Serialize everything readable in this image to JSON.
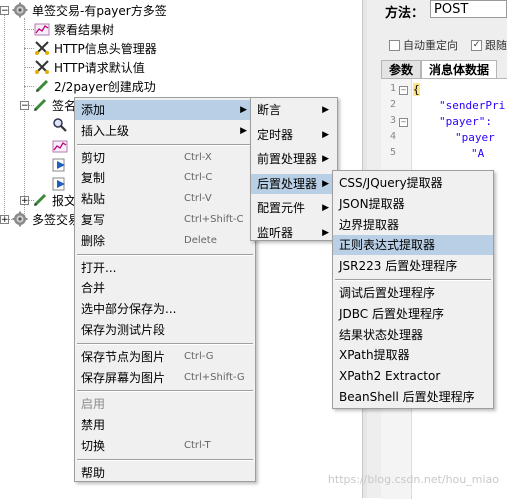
{
  "tree": {
    "nodes": [
      {
        "label": "单签交易-有payer方多签",
        "icon": "thread-group-gear-icon"
      },
      {
        "label": "察看结果树",
        "icon": "results-tree-graph-icon"
      },
      {
        "label": "HTTP信息头管理器",
        "icon": "http-header-manager-scissors-icon"
      },
      {
        "label": "HTTP请求默认值",
        "icon": "http-defaults-scissors-icon"
      },
      {
        "label": "2/2payer创建成功",
        "icon": "sampler-pencil-icon"
      },
      {
        "label": "签名",
        "icon": "sampler-pencil-icon"
      },
      {
        "label": "报文",
        "icon": "sampler-pencil-icon"
      },
      {
        "label": "多签交易",
        "icon": "thread-group-gear-icon"
      }
    ]
  },
  "right_panel": {
    "method_label": "方法：",
    "method_value": "POST",
    "auto_redirect_label": "自动重定向",
    "follow_redirect_label": "跟随",
    "tabs": [
      "参数",
      "消息体数据"
    ],
    "code_lines": [
      {
        "n": "1",
        "text": "{"
      },
      {
        "n": "2",
        "text": "\"senderPri"
      },
      {
        "n": "3",
        "text": "\"payer\":"
      },
      {
        "n": "4",
        "text": "\"payer"
      },
      {
        "n": "5",
        "text": "\"A"
      }
    ]
  },
  "context_menu": {
    "items": [
      {
        "label": "添加",
        "shortcut": "",
        "submenu": true,
        "highlight": true,
        "disabled": false
      },
      {
        "label": "插入上级",
        "shortcut": "",
        "submenu": true,
        "highlight": false,
        "disabled": false
      },
      {
        "label": "剪切",
        "shortcut": "Ctrl-X",
        "submenu": false,
        "highlight": false,
        "disabled": false
      },
      {
        "label": "复制",
        "shortcut": "Ctrl-C",
        "submenu": false,
        "highlight": false,
        "disabled": false
      },
      {
        "label": "粘贴",
        "shortcut": "Ctrl-V",
        "submenu": false,
        "highlight": false,
        "disabled": false
      },
      {
        "label": "复写",
        "shortcut": "Ctrl+Shift-C",
        "submenu": false,
        "highlight": false,
        "disabled": false
      },
      {
        "label": "删除",
        "shortcut": "Delete",
        "submenu": false,
        "highlight": false,
        "disabled": false
      },
      {
        "label": "打开...",
        "shortcut": "",
        "submenu": false,
        "highlight": false,
        "disabled": false
      },
      {
        "label": "合并",
        "shortcut": "",
        "submenu": false,
        "highlight": false,
        "disabled": false
      },
      {
        "label": "选中部分保存为...",
        "shortcut": "",
        "submenu": false,
        "highlight": false,
        "disabled": false
      },
      {
        "label": "保存为测试片段",
        "shortcut": "",
        "submenu": false,
        "highlight": false,
        "disabled": false
      },
      {
        "label": "保存节点为图片",
        "shortcut": "Ctrl-G",
        "submenu": false,
        "highlight": false,
        "disabled": false
      },
      {
        "label": "保存屏幕为图片",
        "shortcut": "Ctrl+Shift-G",
        "submenu": false,
        "highlight": false,
        "disabled": false
      },
      {
        "label": "启用",
        "shortcut": "",
        "submenu": false,
        "highlight": false,
        "disabled": true
      },
      {
        "label": "禁用",
        "shortcut": "",
        "submenu": false,
        "highlight": false,
        "disabled": false
      },
      {
        "label": "切换",
        "shortcut": "Ctrl-T",
        "submenu": false,
        "highlight": false,
        "disabled": false
      },
      {
        "label": "帮助",
        "shortcut": "",
        "submenu": false,
        "highlight": false,
        "disabled": false
      }
    ]
  },
  "add_submenu": {
    "items": [
      {
        "label": "断言",
        "highlight": false
      },
      {
        "label": "定时器",
        "highlight": false
      },
      {
        "label": "前置处理器",
        "highlight": false
      },
      {
        "label": "后置处理器",
        "highlight": true
      },
      {
        "label": "配置元件",
        "highlight": false
      },
      {
        "label": "监听器",
        "highlight": false
      }
    ]
  },
  "post_processor_submenu": {
    "items": [
      {
        "label": "CSS/JQuery提取器",
        "highlight": false
      },
      {
        "label": "JSON提取器",
        "highlight": false
      },
      {
        "label": "边界提取器",
        "highlight": false
      },
      {
        "label": "正则表达式提取器",
        "highlight": true
      },
      {
        "label": "JSR223 后置处理程序",
        "highlight": false
      },
      {
        "label": "调试后置处理程序",
        "highlight": false
      },
      {
        "label": "JDBC 后置处理程序",
        "highlight": false
      },
      {
        "label": "结果状态处理器",
        "highlight": false
      },
      {
        "label": "XPath提取器",
        "highlight": false
      },
      {
        "label": "XPath2 Extractor",
        "highlight": false
      },
      {
        "label": "BeanShell 后置处理程序",
        "highlight": false
      }
    ]
  },
  "watermark": "https://blog.csdn.net/hou_miao",
  "colors": {
    "menu_bg": "#f0f0f0",
    "highlight": "#b8cfe5",
    "string": "#2a00ff"
  }
}
